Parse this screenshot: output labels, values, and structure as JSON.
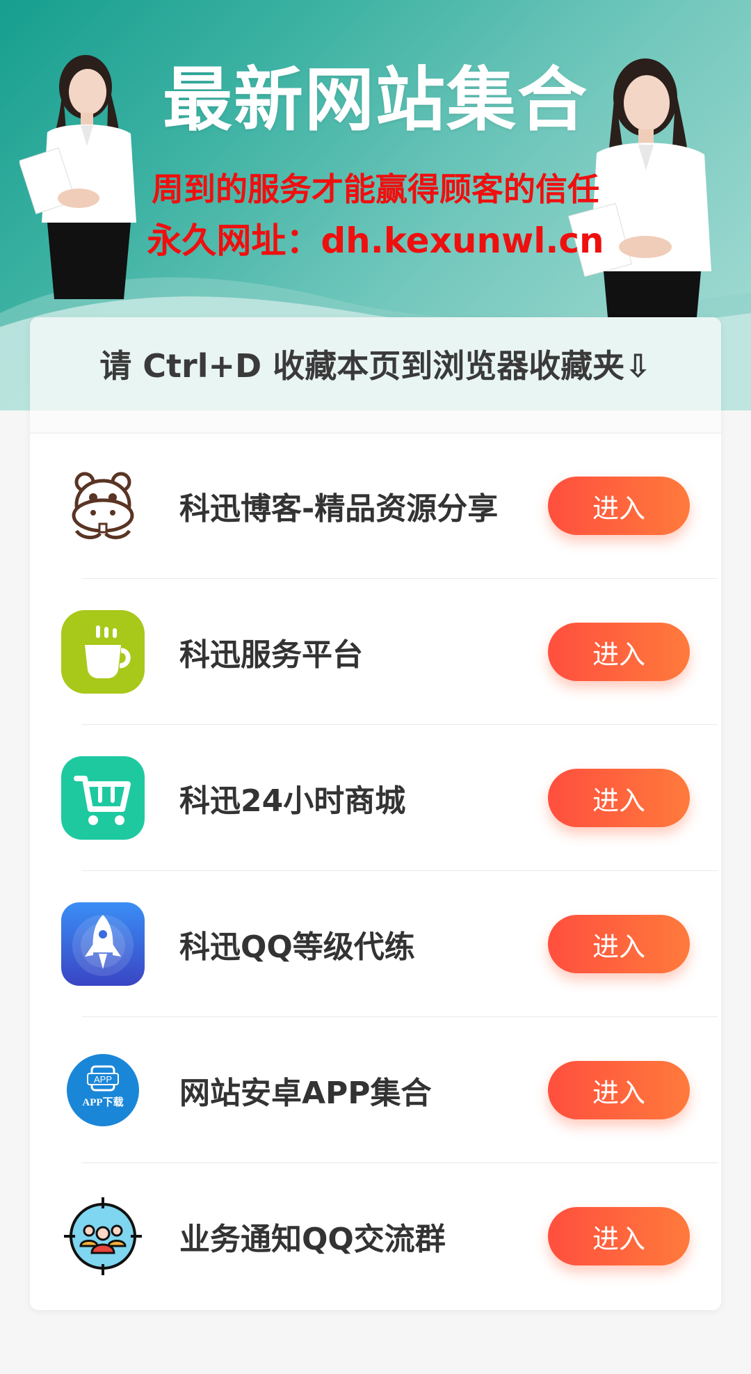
{
  "hero": {
    "title": "最新网站集合",
    "subtitle": "周到的服务才能赢得顾客的信任",
    "address": "永久网址：dh.kexunwl.cn"
  },
  "notice": {
    "text": "请 Ctrl+D 收藏本页到浏览器收藏夹⇩"
  },
  "items": [
    {
      "label": "科迅博客-精品资源分享",
      "button": "进入",
      "icon": "hippo-icon"
    },
    {
      "label": "科迅服务平台",
      "button": "进入",
      "icon": "coffee-cup-icon"
    },
    {
      "label": "科迅24小时商城",
      "button": "进入",
      "icon": "shopping-cart-icon"
    },
    {
      "label": "科迅QQ等级代练",
      "button": "进入",
      "icon": "rocket-icon"
    },
    {
      "label": "网站安卓APP集合",
      "button": "进入",
      "icon": "app-download-icon",
      "icon_text_top": "APP",
      "icon_text_bottom": "APP下载"
    },
    {
      "label": "业务通知QQ交流群",
      "button": "进入",
      "icon": "group-target-icon"
    }
  ],
  "colors": {
    "hero_gradient_start": "#169e8e",
    "hero_gradient_end": "#a9ddd6",
    "red_text": "#ef0f0f",
    "button_start": "#ff4f3e",
    "button_end": "#ff7a3c"
  }
}
